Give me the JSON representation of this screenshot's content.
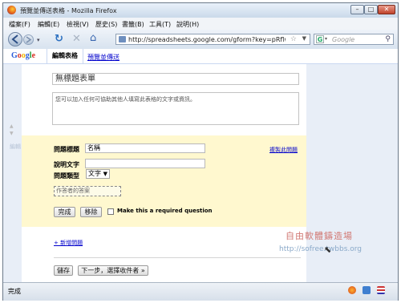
{
  "window": {
    "title": "預覽並傳送表格 - Mozilla Firefox"
  },
  "menu": [
    "檔案(F)",
    "編輯(E)",
    "檢視(V)",
    "歷史(S)",
    "書籤(B)",
    "工具(T)",
    "說明(H)"
  ],
  "nav": {
    "url": "http://spreadsheets.google.com/gform?key=pRflwonjg-8eTI",
    "search_placeholder": "Google"
  },
  "google_bar": {
    "logo": "Google",
    "tab_edit": "編輯表格",
    "tab_view": "預覽並傳送"
  },
  "form": {
    "title": "無標題表單",
    "description": "您可以加入任何可協助其他人填寫此表格的文字或資訊。",
    "question": {
      "side_label": "編輯",
      "title_label": "問題標題",
      "title_value": "名稱",
      "copy_link": "複製此問題",
      "help_label": "說明文字",
      "help_value": "",
      "type_label": "問題類型",
      "type_value": "文字",
      "answer_placeholder": "作答者的答案",
      "done_button": "完成",
      "delete_button": "移除",
      "required_label": "Make this a required question",
      "required_checked": false
    },
    "add_question": "+ 新增問題",
    "save_button": "儲存",
    "next_button": "下一步，選擇收件者 »"
  },
  "watermark": {
    "text": "http://sofree.twbbs.org",
    "logo": "自由軟體鑄造場"
  },
  "status": {
    "text": "完成"
  }
}
